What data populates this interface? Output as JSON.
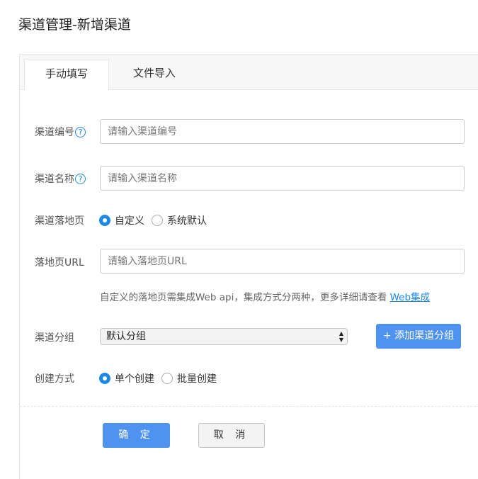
{
  "page_title": "渠道管理-新增渠道",
  "tabs": [
    {
      "label": "手动填写",
      "active": true
    },
    {
      "label": "文件导入",
      "active": false
    }
  ],
  "form": {
    "channel_code": {
      "label": "渠道编号",
      "help": "?",
      "placeholder": "请输入渠道编号",
      "value": ""
    },
    "channel_name": {
      "label": "渠道名称",
      "help": "?",
      "placeholder": "请输入渠道名称",
      "value": ""
    },
    "landing_page": {
      "label": "渠道落地页",
      "options": [
        {
          "label": "自定义",
          "checked": true
        },
        {
          "label": "系统默认",
          "checked": false
        }
      ]
    },
    "landing_url": {
      "label": "落地页URL",
      "placeholder": "请输入落地页URL",
      "value": ""
    },
    "hint": {
      "text": "自定义的落地页需集成Web api，集成方式分两种，更多详细请查看 ",
      "link_text": "Web集成"
    },
    "channel_group": {
      "label": "渠道分组",
      "selected": "默认分组",
      "add_button": "+ 添加渠道分组"
    },
    "create_mode": {
      "label": "创建方式",
      "options": [
        {
          "label": "单个创建",
          "checked": true
        },
        {
          "label": "批量创建",
          "checked": false
        }
      ]
    }
  },
  "actions": {
    "confirm": "确 定",
    "cancel": "取 消"
  },
  "colors": {
    "accent": "#4f93f0",
    "link": "#1e88e5"
  }
}
